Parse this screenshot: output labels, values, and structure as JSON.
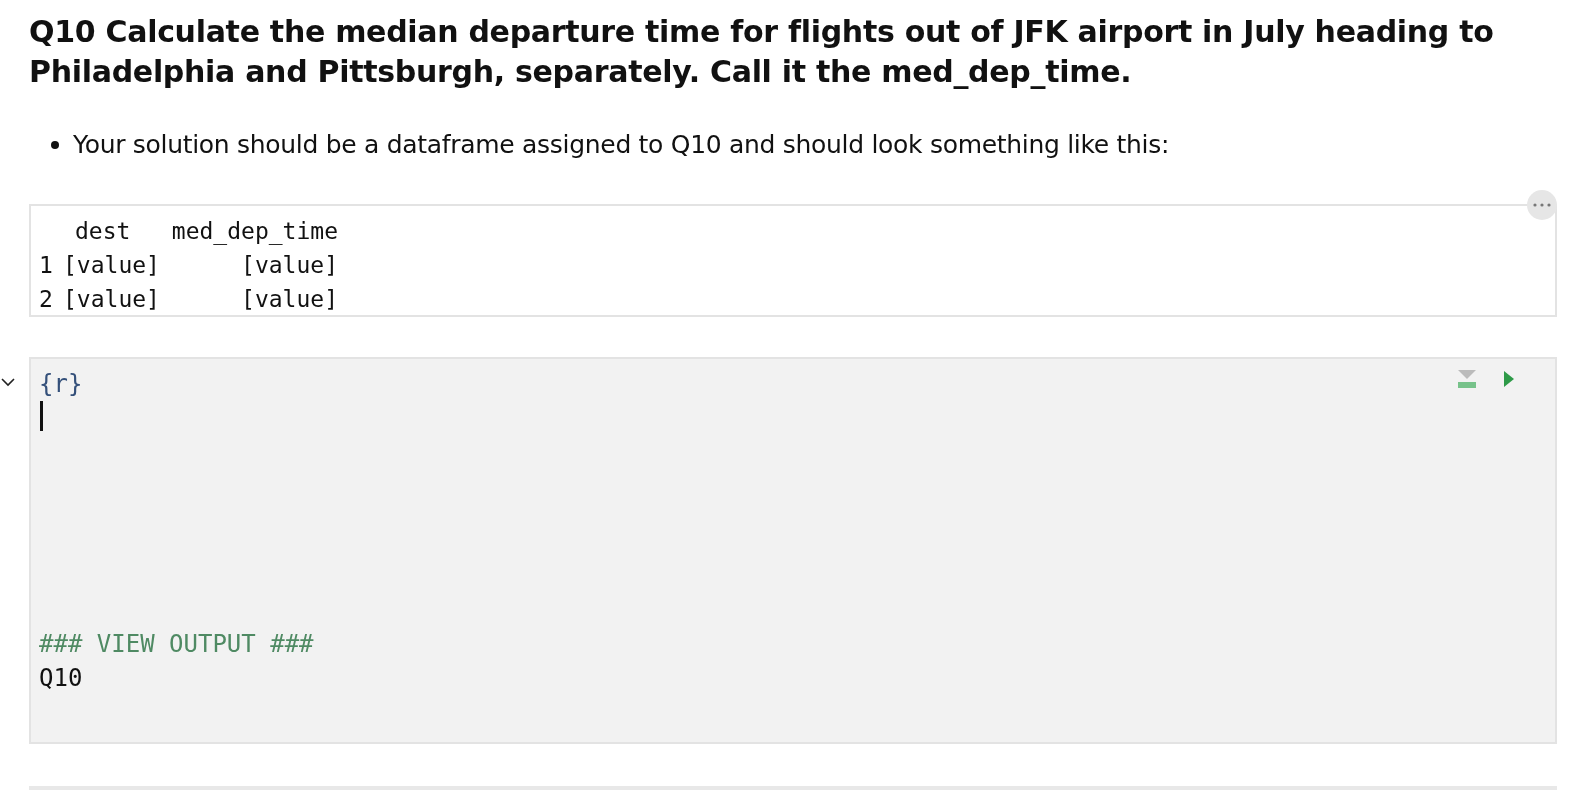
{
  "heading": "Q10 Calculate the median departure time for flights out of JFK airport in July heading to Philadelphia and Pittsburgh, separately. Call it the med_dep_time.",
  "bullets": [
    "Your solution should be a dataframe assigned to Q10 and should look something like this:"
  ],
  "output": {
    "columns": [
      "dest",
      "med_dep_time"
    ],
    "rows": [
      {
        "index": "1",
        "cells": [
          "[value]",
          "[value]"
        ]
      },
      {
        "index": "2",
        "cells": [
          "[value]",
          "[value]"
        ]
      }
    ]
  },
  "code_cell": {
    "expanded": true,
    "cursor": true,
    "lines": [
      {
        "kind": "chunk-header",
        "text": "{r}"
      },
      {
        "kind": "comment",
        "text": "### VIEW OUTPUT ###"
      },
      {
        "kind": "code",
        "text": "Q10"
      }
    ]
  }
}
